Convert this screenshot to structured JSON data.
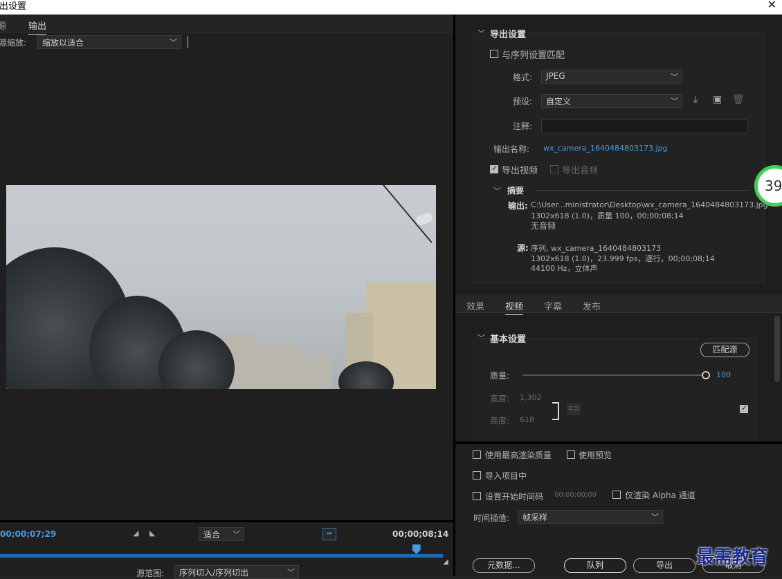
{
  "window": {
    "title": "导出设置",
    "close_icon": "close-icon"
  },
  "left": {
    "tabs": [
      "源",
      "输出"
    ],
    "source_zoom_label": "源缩放:",
    "source_zoom_value": "缩放以适合",
    "timecode_current": "00;00;07;29",
    "fit_value": "适合",
    "timecode_end": "00;00;08;14",
    "source_range_label": "源范围:",
    "source_range_value": "序列切入/序列切出",
    "playhead_progress": 0.94
  },
  "export": {
    "section_title": "导出设置",
    "match_sequence": "与序列设置匹配",
    "format_label": "格式:",
    "format_value": "JPEG",
    "preset_label": "预设:",
    "preset_value": "自定义",
    "comment_label": "注释:",
    "comment_value": "",
    "output_name_label": "输出名称:",
    "output_name_value": "wx_camera_1640484803173.jpg",
    "export_video": "导出视频",
    "export_audio": "导出音频",
    "summary_title": "摘要",
    "summary_output_label": "输出:",
    "summary_output_path": "C:\\User...ministrator\\Desktop\\wx_camera_1640484803173.jpg",
    "summary_output_line2": "1302x618 (1.0)，质量 100，00;00;08;14",
    "summary_output_line3": "无音频",
    "summary_source_label": "源:",
    "summary_source_line1": "序列, wx_camera_1640484803173",
    "summary_source_line2": "1302x618 (1.0)，23.999 fps，逐行，00;00;08;14",
    "summary_source_line3": "44100 Hz，立体声",
    "badge": "39"
  },
  "settings_tabs": [
    "效果",
    "视频",
    "字幕",
    "发布"
  ],
  "basic": {
    "section_title": "基本设置",
    "match_source": "匹配源",
    "quality_label": "质量:",
    "quality_value": "100",
    "quality_progress": 1.0,
    "width_label": "宽度:",
    "width_value": "1,302",
    "height_label": "高度:",
    "height_value": "618"
  },
  "bottom": {
    "max_render": "使用最高渲染质量",
    "use_preview": "使用预览",
    "import_project": "导入项目中",
    "set_start_tc": "设置开始时间码",
    "start_tc_value": "00;00;00;00",
    "render_alpha": "仅渲染 Alpha 通道",
    "interp_label": "时间插值:",
    "interp_value": "帧采样",
    "metadata_btn": "元数据...",
    "queue_btn": "队列",
    "export_btn": "导出",
    "cancel_btn": "取消"
  },
  "watermark": "最需教育"
}
